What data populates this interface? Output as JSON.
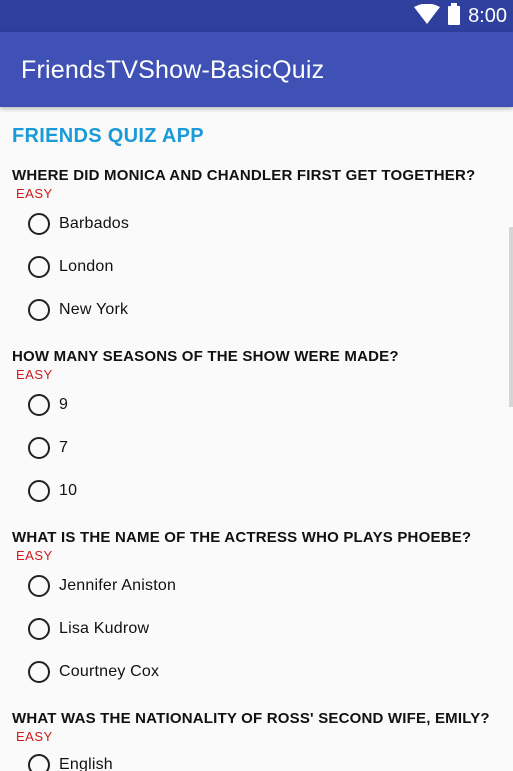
{
  "status_bar": {
    "time": "8:00",
    "icons": [
      "wifi-icon",
      "battery-icon"
    ]
  },
  "app_bar": {
    "title": "FriendsTVShow-BasicQuiz"
  },
  "quiz": {
    "heading": "FRIENDS QUIZ APP",
    "questions": [
      {
        "text": "WHERE DID MONICA AND CHANDLER FIRST GET TOGETHER?",
        "difficulty": "EASY",
        "options": [
          "Barbados",
          "London",
          "New York"
        ]
      },
      {
        "text": "HOW MANY SEASONS OF THE SHOW WERE MADE?",
        "difficulty": "EASY",
        "options": [
          "9",
          "7",
          "10"
        ]
      },
      {
        "text": "WHAT IS THE NAME OF THE ACTRESS WHO PLAYS PHOEBE?",
        "difficulty": "EASY",
        "options": [
          "Jennifer Aniston",
          "Lisa Kudrow",
          "Courtney Cox"
        ]
      },
      {
        "text": "WHAT WAS THE NATIONALITY OF ROSS' SECOND WIFE, EMILY?",
        "difficulty": "EASY",
        "options": [
          "English"
        ]
      }
    ]
  },
  "colors": {
    "status_bar": "#2f3f9e",
    "app_bar": "#3f51b5",
    "heading": "#1a9ad6",
    "difficulty": "#d01818"
  }
}
